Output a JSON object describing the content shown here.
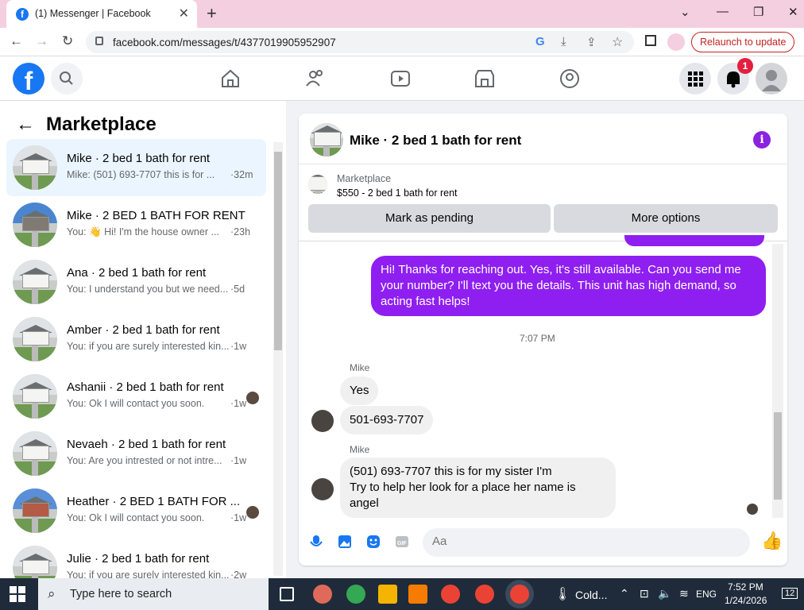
{
  "browser": {
    "tab_title": "(1) Messenger | Facebook",
    "tab_favicon": "f",
    "url": "facebook.com/messages/t/4377019905952907",
    "relaunch_label": "Relaunch to update"
  },
  "fb": {
    "logo": "f",
    "notification_count": "1"
  },
  "left": {
    "title": "Marketplace",
    "back_icon": "←",
    "conversations": [
      {
        "name": "Mike · 2 bed 1 bath for rent",
        "snippet": "Mike: (501) 693-7707 this is for ...",
        "time": "·32m"
      },
      {
        "name": "Mike · 2 BED 1 BATH FOR RENT",
        "snippet": "You: 👋 Hi! I'm the house owner ...",
        "time": "·23h"
      },
      {
        "name": "Ana · 2 bed 1 bath for rent",
        "snippet": "You: I understand you but we need...",
        "time": "·5d"
      },
      {
        "name": "Amber · 2 bed 1 bath for rent",
        "snippet": "You: if you are surely interested kin...",
        "time": "·1w"
      },
      {
        "name": "Ashanii · 2 bed 1 bath for rent",
        "snippet": "You: Ok I will contact you soon.",
        "time": "·1w"
      },
      {
        "name": "Nevaeh · 2 bed 1 bath for rent",
        "snippet": "You: Are you intrested or not intre...",
        "time": "·1w"
      },
      {
        "name": "Heather · 2 BED 1 BATH FOR ...",
        "snippet": "You: Ok I will contact you soon.",
        "time": "·1w"
      },
      {
        "name": "Julie · 2 bed 1 bath for rent",
        "snippet": "You: if you are surely interested kin...",
        "time": "·2w"
      }
    ]
  },
  "chat": {
    "title": "Mike · 2 bed 1 bath for rent",
    "marketplace_label": "Marketplace",
    "listing": "$550 - 2 bed 1 bath for rent",
    "mark_pending": "Mark as pending",
    "more_options": "More options",
    "outgoing_message": "Hi!  Thanks for reaching out.  Yes, it's still available.  Can you send me your number? I'll  text you the details.  This unit has high demand, so acting fast helps!",
    "timestamp": "7:07 PM",
    "sender1": "Mike",
    "msg_yes": "Yes",
    "msg_phone": "501-693-7707",
    "sender2": "Mike",
    "msg_long_line1": "(501) 693-7707 this is for my sister I'm",
    "msg_long_line2": "Try to help her look for a place her name is angel",
    "composer_placeholder": "Aa"
  },
  "taskbar": {
    "search_placeholder": "Type here to search",
    "weather": "Cold...",
    "lang": "ENG",
    "time": "7:52 PM",
    "date": "1/24/2026",
    "notif": "12"
  },
  "colors": {
    "brand": "#1877f2",
    "outgoing_bubble": "#8e1ff0",
    "accent_purple": "#8a22e0"
  }
}
